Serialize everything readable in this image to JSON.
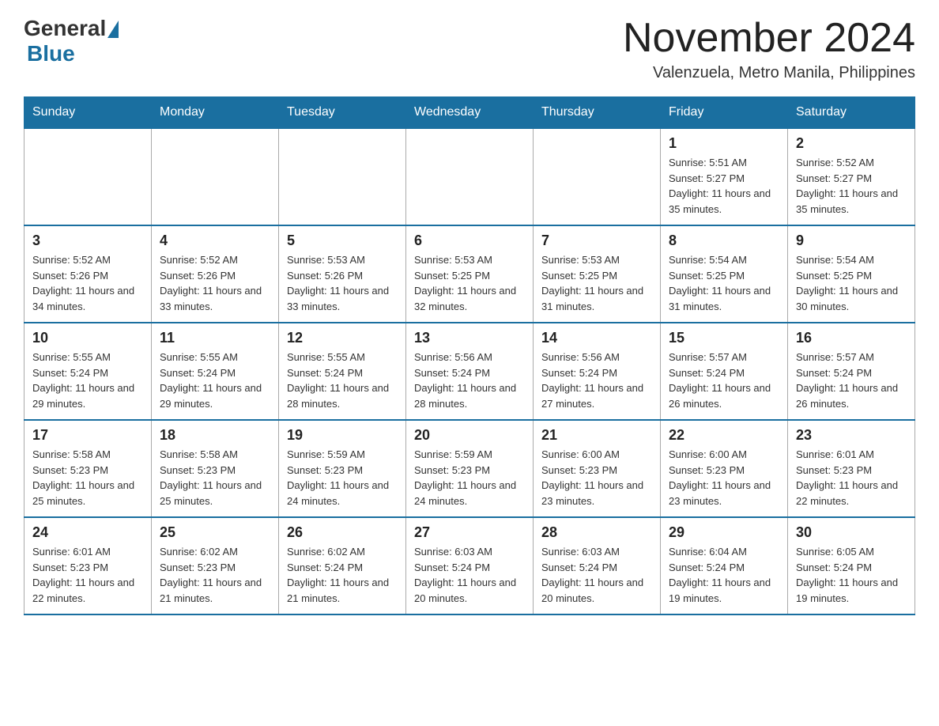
{
  "header": {
    "logo_general": "General",
    "logo_blue": "Blue",
    "month_title": "November 2024",
    "location": "Valenzuela, Metro Manila, Philippines"
  },
  "calendar": {
    "days_of_week": [
      "Sunday",
      "Monday",
      "Tuesday",
      "Wednesday",
      "Thursday",
      "Friday",
      "Saturday"
    ],
    "weeks": [
      [
        {
          "day": "",
          "info": ""
        },
        {
          "day": "",
          "info": ""
        },
        {
          "day": "",
          "info": ""
        },
        {
          "day": "",
          "info": ""
        },
        {
          "day": "",
          "info": ""
        },
        {
          "day": "1",
          "info": "Sunrise: 5:51 AM\nSunset: 5:27 PM\nDaylight: 11 hours and 35 minutes."
        },
        {
          "day": "2",
          "info": "Sunrise: 5:52 AM\nSunset: 5:27 PM\nDaylight: 11 hours and 35 minutes."
        }
      ],
      [
        {
          "day": "3",
          "info": "Sunrise: 5:52 AM\nSunset: 5:26 PM\nDaylight: 11 hours and 34 minutes."
        },
        {
          "day": "4",
          "info": "Sunrise: 5:52 AM\nSunset: 5:26 PM\nDaylight: 11 hours and 33 minutes."
        },
        {
          "day": "5",
          "info": "Sunrise: 5:53 AM\nSunset: 5:26 PM\nDaylight: 11 hours and 33 minutes."
        },
        {
          "day": "6",
          "info": "Sunrise: 5:53 AM\nSunset: 5:25 PM\nDaylight: 11 hours and 32 minutes."
        },
        {
          "day": "7",
          "info": "Sunrise: 5:53 AM\nSunset: 5:25 PM\nDaylight: 11 hours and 31 minutes."
        },
        {
          "day": "8",
          "info": "Sunrise: 5:54 AM\nSunset: 5:25 PM\nDaylight: 11 hours and 31 minutes."
        },
        {
          "day": "9",
          "info": "Sunrise: 5:54 AM\nSunset: 5:25 PM\nDaylight: 11 hours and 30 minutes."
        }
      ],
      [
        {
          "day": "10",
          "info": "Sunrise: 5:55 AM\nSunset: 5:24 PM\nDaylight: 11 hours and 29 minutes."
        },
        {
          "day": "11",
          "info": "Sunrise: 5:55 AM\nSunset: 5:24 PM\nDaylight: 11 hours and 29 minutes."
        },
        {
          "day": "12",
          "info": "Sunrise: 5:55 AM\nSunset: 5:24 PM\nDaylight: 11 hours and 28 minutes."
        },
        {
          "day": "13",
          "info": "Sunrise: 5:56 AM\nSunset: 5:24 PM\nDaylight: 11 hours and 28 minutes."
        },
        {
          "day": "14",
          "info": "Sunrise: 5:56 AM\nSunset: 5:24 PM\nDaylight: 11 hours and 27 minutes."
        },
        {
          "day": "15",
          "info": "Sunrise: 5:57 AM\nSunset: 5:24 PM\nDaylight: 11 hours and 26 minutes."
        },
        {
          "day": "16",
          "info": "Sunrise: 5:57 AM\nSunset: 5:24 PM\nDaylight: 11 hours and 26 minutes."
        }
      ],
      [
        {
          "day": "17",
          "info": "Sunrise: 5:58 AM\nSunset: 5:23 PM\nDaylight: 11 hours and 25 minutes."
        },
        {
          "day": "18",
          "info": "Sunrise: 5:58 AM\nSunset: 5:23 PM\nDaylight: 11 hours and 25 minutes."
        },
        {
          "day": "19",
          "info": "Sunrise: 5:59 AM\nSunset: 5:23 PM\nDaylight: 11 hours and 24 minutes."
        },
        {
          "day": "20",
          "info": "Sunrise: 5:59 AM\nSunset: 5:23 PM\nDaylight: 11 hours and 24 minutes."
        },
        {
          "day": "21",
          "info": "Sunrise: 6:00 AM\nSunset: 5:23 PM\nDaylight: 11 hours and 23 minutes."
        },
        {
          "day": "22",
          "info": "Sunrise: 6:00 AM\nSunset: 5:23 PM\nDaylight: 11 hours and 23 minutes."
        },
        {
          "day": "23",
          "info": "Sunrise: 6:01 AM\nSunset: 5:23 PM\nDaylight: 11 hours and 22 minutes."
        }
      ],
      [
        {
          "day": "24",
          "info": "Sunrise: 6:01 AM\nSunset: 5:23 PM\nDaylight: 11 hours and 22 minutes."
        },
        {
          "day": "25",
          "info": "Sunrise: 6:02 AM\nSunset: 5:23 PM\nDaylight: 11 hours and 21 minutes."
        },
        {
          "day": "26",
          "info": "Sunrise: 6:02 AM\nSunset: 5:24 PM\nDaylight: 11 hours and 21 minutes."
        },
        {
          "day": "27",
          "info": "Sunrise: 6:03 AM\nSunset: 5:24 PM\nDaylight: 11 hours and 20 minutes."
        },
        {
          "day": "28",
          "info": "Sunrise: 6:03 AM\nSunset: 5:24 PM\nDaylight: 11 hours and 20 minutes."
        },
        {
          "day": "29",
          "info": "Sunrise: 6:04 AM\nSunset: 5:24 PM\nDaylight: 11 hours and 19 minutes."
        },
        {
          "day": "30",
          "info": "Sunrise: 6:05 AM\nSunset: 5:24 PM\nDaylight: 11 hours and 19 minutes."
        }
      ]
    ]
  }
}
